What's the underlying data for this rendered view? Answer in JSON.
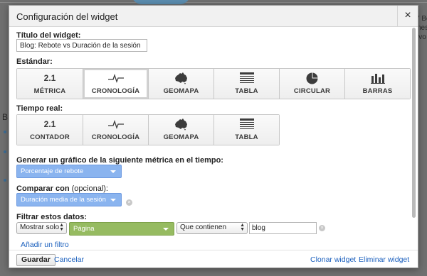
{
  "background": {
    "right_lines": [
      "\" Bc",
      "nes",
      "ivo"
    ],
    "left_letter": "B"
  },
  "dialog": {
    "title": "Configuración del widget",
    "close_glyph": "×",
    "widget_title_label": "Título del widget:",
    "widget_title_value": "Blog: Rebote vs Duración de la sesión",
    "standard_label": "Estándar:",
    "standard_types": [
      {
        "icon": "metric-icon",
        "glyph": "2.1",
        "label": "MÉTRICA",
        "selected": false
      },
      {
        "icon": "timeline-icon",
        "label": "CRONOLOGÍA",
        "selected": true
      },
      {
        "icon": "geomap-icon",
        "label": "GEOMAPA",
        "selected": false
      },
      {
        "icon": "table-icon",
        "label": "TABLA",
        "selected": false
      },
      {
        "icon": "pie-icon",
        "label": "CIRCULAR",
        "selected": false
      },
      {
        "icon": "bars-icon",
        "label": "BARRAS",
        "selected": false
      }
    ],
    "realtime_label": "Tiempo real:",
    "realtime_types": [
      {
        "icon": "counter-icon",
        "glyph": "2.1",
        "label": "CONTADOR",
        "selected": false
      },
      {
        "icon": "timeline-icon",
        "label": "CRONOLOGÍA",
        "selected": false
      },
      {
        "icon": "geomap-icon",
        "label": "GEOMAPA",
        "selected": false
      },
      {
        "icon": "table-icon",
        "label": "TABLA",
        "selected": false
      }
    ],
    "metric_label": "Generar un gráfico de la siguiente métrica en el tiempo:",
    "metric_value": "Porcentaje de rebote",
    "compare_label_bold": "Comparar con",
    "compare_label_normal": " (opcional):",
    "compare_value": "Duración media de la sesión",
    "filter_label": "Filtrar estos datos:",
    "filter_mode": "Mostrar solo",
    "filter_dimension": "Página",
    "filter_operator": "Que contienen",
    "filter_value": "blog",
    "add_filter": "Añadir un filtro",
    "colors": {
      "metric_select": "#8ab4ef",
      "dimension_select": "#96bb61",
      "link": "#1a5fbd"
    }
  },
  "footer": {
    "save": "Guardar",
    "cancel": "Cancelar",
    "clone": "Clonar widget",
    "delete": "Eliminar widget"
  }
}
